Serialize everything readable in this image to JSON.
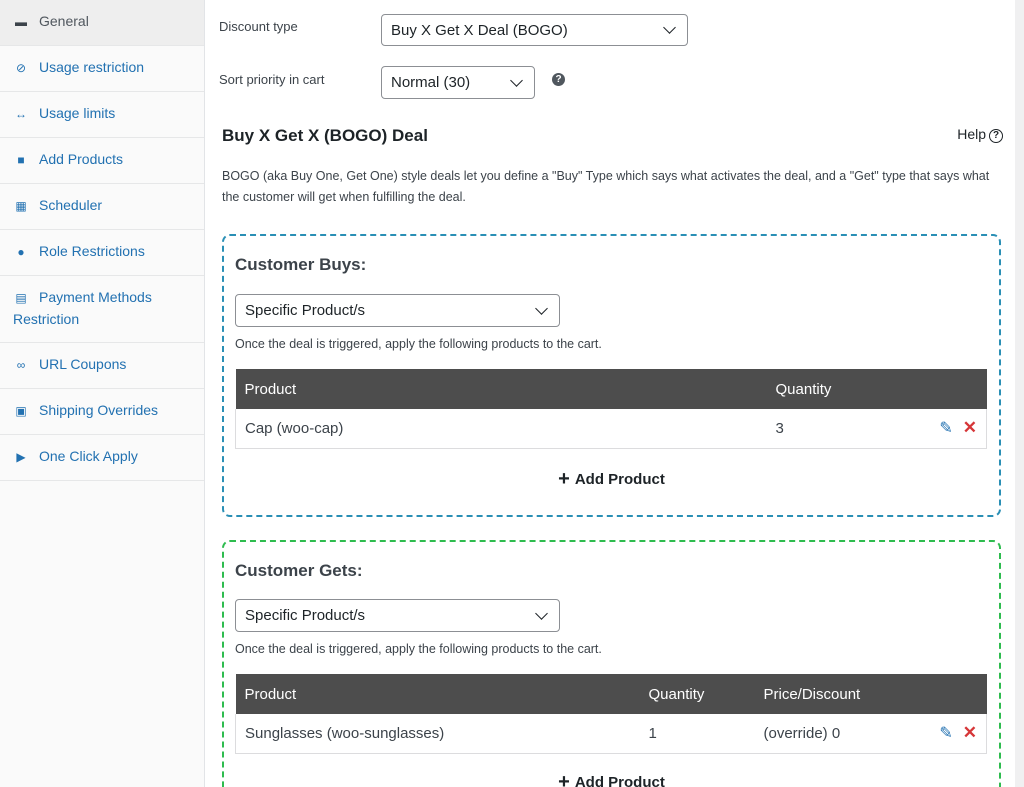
{
  "sidebar": {
    "items": [
      {
        "label": "General",
        "icon": "wrench-icon",
        "active": true
      },
      {
        "label": "Usage restriction",
        "icon": "ban-icon"
      },
      {
        "label": "Usage limits",
        "icon": "arrows-icon"
      },
      {
        "label": "Add Products",
        "icon": "bag-icon"
      },
      {
        "label": "Scheduler",
        "icon": "calendar-icon"
      },
      {
        "label": "Role Restrictions",
        "icon": "user-icon"
      },
      {
        "label": "Payment Methods Restriction",
        "icon": "credit-card-icon"
      },
      {
        "label": "URL Coupons",
        "icon": "link-icon"
      },
      {
        "label": "Shipping Overrides",
        "icon": "truck-icon"
      },
      {
        "label": "One Click Apply",
        "icon": "megaphone-icon"
      }
    ]
  },
  "fields": {
    "discount_type_label": "Discount type",
    "discount_type_value": "Buy X Get X Deal (BOGO)",
    "sort_priority_label": "Sort priority in cart",
    "sort_priority_value": "Normal (30)"
  },
  "deal": {
    "title": "Buy X Get X (BOGO) Deal",
    "help_label": "Help",
    "description": "BOGO (aka Buy One, Get One) style deals let you define a \"Buy\" Type which says what activates the deal, and a \"Get\" type that says what the customer will get when fulfilling the deal."
  },
  "buys": {
    "title": "Customer Buys:",
    "select_value": "Specific Product/s",
    "note": "Once the deal is triggered, apply the following products to the cart.",
    "columns": [
      "Product",
      "Quantity"
    ],
    "rows": [
      {
        "product": "Cap (woo-cap)",
        "quantity": "3"
      }
    ],
    "add_label": "Add Product"
  },
  "gets": {
    "title": "Customer Gets:",
    "select_value": "Specific Product/s",
    "note": "Once the deal is triggered, apply the following products to the cart.",
    "columns": [
      "Product",
      "Quantity",
      "Price/Discount"
    ],
    "rows": [
      {
        "product": "Sunglasses (woo-sunglasses)",
        "quantity": "1",
        "price": "(override) 0"
      }
    ],
    "add_label": "Add Product"
  },
  "colors": {
    "accent": "#2271b1",
    "buys_border": "#2a8fb5",
    "gets_border": "#2ebc4f",
    "table_header": "#4d4d4d",
    "delete": "#d63638"
  }
}
